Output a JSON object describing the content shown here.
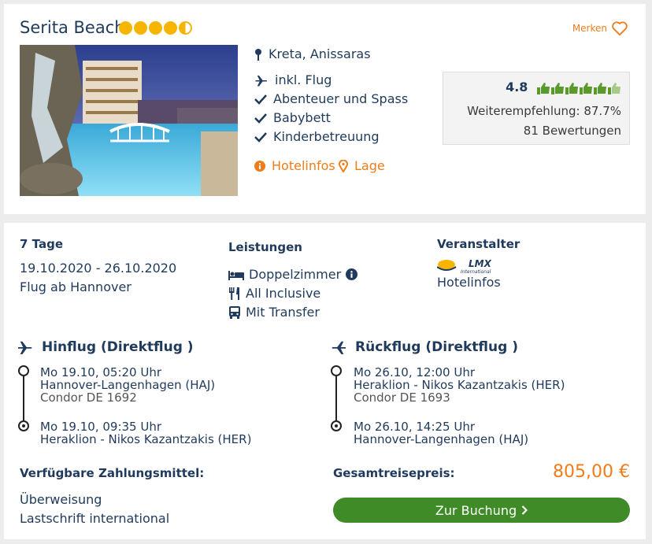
{
  "hotel": {
    "name": "Serita Beach",
    "stars": 4.5,
    "merken_label": "Merken",
    "location": "Kreta, Anissaras",
    "features": [
      "inkl. Flug",
      "Abenteuer und Spass",
      "Babybett",
      "Kinderbetreuung"
    ],
    "links": {
      "hotelinfos": "Hotelinfos",
      "lage": "Lage"
    }
  },
  "rating": {
    "score": "4.8",
    "thumbs_filled": 5.5,
    "recommendation": "Weiterempfehlung: 87.7%",
    "reviews": "81 Bewertungen"
  },
  "trip": {
    "duration": "7 Tage",
    "dates": "19.10.2020 - 26.10.2020",
    "departure": "Flug ab Hannover"
  },
  "services": {
    "title": "Leistungen",
    "items": [
      "Doppelzimmer",
      "All Inclusive",
      "Mit Transfer"
    ]
  },
  "operator": {
    "title": "Veranstalter",
    "logo_text": "LMX",
    "logo_sub": "International",
    "link": "Hotelinfos"
  },
  "outbound": {
    "title": "Hinflug (Direktflug )",
    "dep_time": "Mo 19.10, 05:20 Uhr",
    "dep_airport": "Hannover-Langenhagen (HAJ)",
    "flight_no": "Condor DE 1692",
    "arr_time": "Mo 19.10, 09:35 Uhr",
    "arr_airport": "Heraklion - Nikos Kazantzakis (HER)"
  },
  "return": {
    "title": "Rückflug (Direktflug )",
    "dep_time": "Mo 26.10, 12:00 Uhr",
    "dep_airport": "Heraklion - Nikos Kazantzakis (HER)",
    "flight_no": "Condor DE 1693",
    "arr_time": "Mo 26.10, 14:25 Uhr",
    "arr_airport": "Hannover-Langenhagen (HAJ)"
  },
  "payment": {
    "title": "Verfügbare Zahlungsmittel:",
    "methods": [
      "Überweisung",
      "Lastschrift international"
    ]
  },
  "total": {
    "label": "Gesamtreisepreis:",
    "price": "805,00 €",
    "button": "Zur Buchung"
  },
  "colors": {
    "accent": "#f07c1a",
    "brand": "#1f3a5c",
    "button": "#3f8b28",
    "star": "#f6b500",
    "thumb": "#5a9a2a"
  }
}
